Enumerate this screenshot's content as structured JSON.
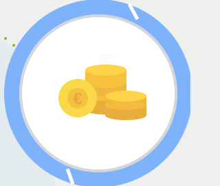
{
  "illustration": {
    "icon": "euro-coins-icon",
    "currency_symbol": "€"
  },
  "colors": {
    "background": "#eef0ee",
    "background_accent": "#e4ebef",
    "ring": "#7eb3fb",
    "ring_gap": "#ffffff",
    "inner_border": "#d3d6da",
    "inner_fill": "#ffffff",
    "coin_light": "#fdd448",
    "coin_mid": "#f6c13e",
    "coin_dark": "#e9ad3c",
    "euro_coin": "#fbd84a",
    "euro_symbol": "#e7a83a",
    "dots": "#96b23c"
  }
}
